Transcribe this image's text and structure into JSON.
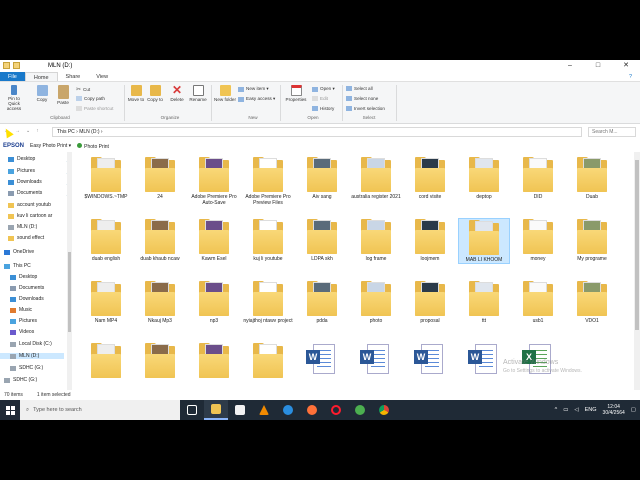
{
  "window": {
    "title": "MLN (D:)",
    "controls": [
      "–",
      "□",
      "✕"
    ]
  },
  "tabs": {
    "file": "File",
    "home": "Home",
    "share": "Share",
    "view": "View"
  },
  "ribbon": {
    "pin": "Pin to Quick access",
    "copy": "Copy",
    "paste": "Paste",
    "cut": "Cut",
    "copy_path": "Copy path",
    "paste_shortcut": "Paste shortcut",
    "move_to": "Move to",
    "copy_to": "Copy to",
    "delete": "Delete",
    "rename": "Rename",
    "new_folder": "New folder",
    "new_item": "New item ▾",
    "easy_access": "Easy access ▾",
    "properties": "Properties",
    "open": "Open ▾",
    "edit": "Edit",
    "history": "History",
    "select_all": "Select all",
    "select_none": "Select none",
    "invert_selection": "Invert selection",
    "groups": {
      "clipboard": "Clipboard",
      "organize": "Organize",
      "new": "New",
      "open": "Open",
      "select": "Select"
    }
  },
  "address": {
    "path": "This PC  ›  MLN (D:)  ›",
    "search_placeholder": "Search M..."
  },
  "epson_bar": {
    "brand": "EPSON",
    "easy_photo_print": "Easy Photo Print ▾",
    "photo_print": "Photo Print"
  },
  "nav": [
    {
      "label": "Desktop",
      "icon": "desktop-icon"
    },
    {
      "label": "Pictures",
      "icon": "pictures-icon"
    },
    {
      "label": "Downloads",
      "icon": "downloads-icon"
    },
    {
      "label": "Documents",
      "icon": "documents-icon"
    },
    {
      "label": "account youtub",
      "icon": "folder-icon"
    },
    {
      "label": "kuv li cartoon ar",
      "icon": "folder-icon"
    },
    {
      "label": "MLN (D:)",
      "icon": "drive-icon"
    },
    {
      "label": "sound effect",
      "icon": "folder-icon"
    },
    {
      "label": "OneDrive",
      "icon": "onedrive-icon"
    },
    {
      "label": "This PC",
      "icon": "pc-icon"
    },
    {
      "label": "Desktop",
      "icon": "desktop-icon"
    },
    {
      "label": "Documents",
      "icon": "documents-icon"
    },
    {
      "label": "Downloads",
      "icon": "downloads-icon"
    },
    {
      "label": "Music",
      "icon": "music-icon"
    },
    {
      "label": "Pictures",
      "icon": "pictures-icon"
    },
    {
      "label": "Videos",
      "icon": "videos-icon"
    },
    {
      "label": "Local Disk (C:)",
      "icon": "drive-icon"
    },
    {
      "label": "MLN (D:)",
      "icon": "drive-icon"
    },
    {
      "label": "SDHC (G:)",
      "icon": "drive-icon"
    },
    {
      "label": "SDHC (G:)",
      "icon": "drive-icon"
    }
  ],
  "items": [
    {
      "label": "$WINDOWS.~TMP",
      "type": "folder"
    },
    {
      "label": "24",
      "type": "folder"
    },
    {
      "label": "Adobe Premiere Pro Auto-Save",
      "type": "folder"
    },
    {
      "label": "Adobe Premiere Pro Preview Files",
      "type": "folder"
    },
    {
      "label": "Aiv sang",
      "type": "folder"
    },
    {
      "label": "australia register 2021",
      "type": "folder"
    },
    {
      "label": "cord visite",
      "type": "folder"
    },
    {
      "label": "deptop",
      "type": "folder"
    },
    {
      "label": "DID",
      "type": "folder"
    },
    {
      "label": "Duab",
      "type": "folder"
    },
    {
      "label": "duab english",
      "type": "folder"
    },
    {
      "label": "duab khaub ncaw",
      "type": "folder"
    },
    {
      "label": "Kawm Esel",
      "type": "folder"
    },
    {
      "label": "kuj li youtube",
      "type": "folder"
    },
    {
      "label": "LDPA skh",
      "type": "folder"
    },
    {
      "label": "log frame",
      "type": "folder"
    },
    {
      "label": "loojmem",
      "type": "folder"
    },
    {
      "label": "MAB LI KHOOM",
      "type": "folder"
    },
    {
      "label": "money",
      "type": "folder"
    },
    {
      "label": "My programe",
      "type": "folder"
    },
    {
      "label": "Nam MP4",
      "type": "folder"
    },
    {
      "label": "Nkauj Mp3",
      "type": "folder"
    },
    {
      "label": "np3",
      "type": "folder"
    },
    {
      "label": "nyiajthoj ntawv project",
      "type": "folder"
    },
    {
      "label": "pdda",
      "type": "folder"
    },
    {
      "label": "photo",
      "type": "folder"
    },
    {
      "label": "proposal",
      "type": "folder"
    },
    {
      "label": "ttt",
      "type": "folder"
    },
    {
      "label": "usb1",
      "type": "folder"
    },
    {
      "label": "VDO1",
      "type": "folder"
    },
    {
      "label": "",
      "type": "folder"
    },
    {
      "label": "",
      "type": "folder"
    },
    {
      "label": "",
      "type": "folder"
    },
    {
      "label": "",
      "type": "folder"
    },
    {
      "label": "",
      "type": "word"
    },
    {
      "label": "",
      "type": "word"
    },
    {
      "label": "",
      "type": "word"
    },
    {
      "label": "",
      "type": "word"
    },
    {
      "label": "",
      "type": "excel"
    }
  ],
  "status": {
    "count": "70 items",
    "selected": "1 item selected"
  },
  "taskbar": {
    "search_placeholder": "Type here to search",
    "lang": "ENG",
    "time": "12:04",
    "date": "30/4/2564"
  },
  "watermark": {
    "line1": "Activate Windows",
    "line2": "Go to Settings to activate Windows."
  },
  "colors": {
    "accent": "#1979ca",
    "folder": "#f0c453",
    "taskbar": "#1f2a36",
    "selection": "#cce8ff"
  }
}
